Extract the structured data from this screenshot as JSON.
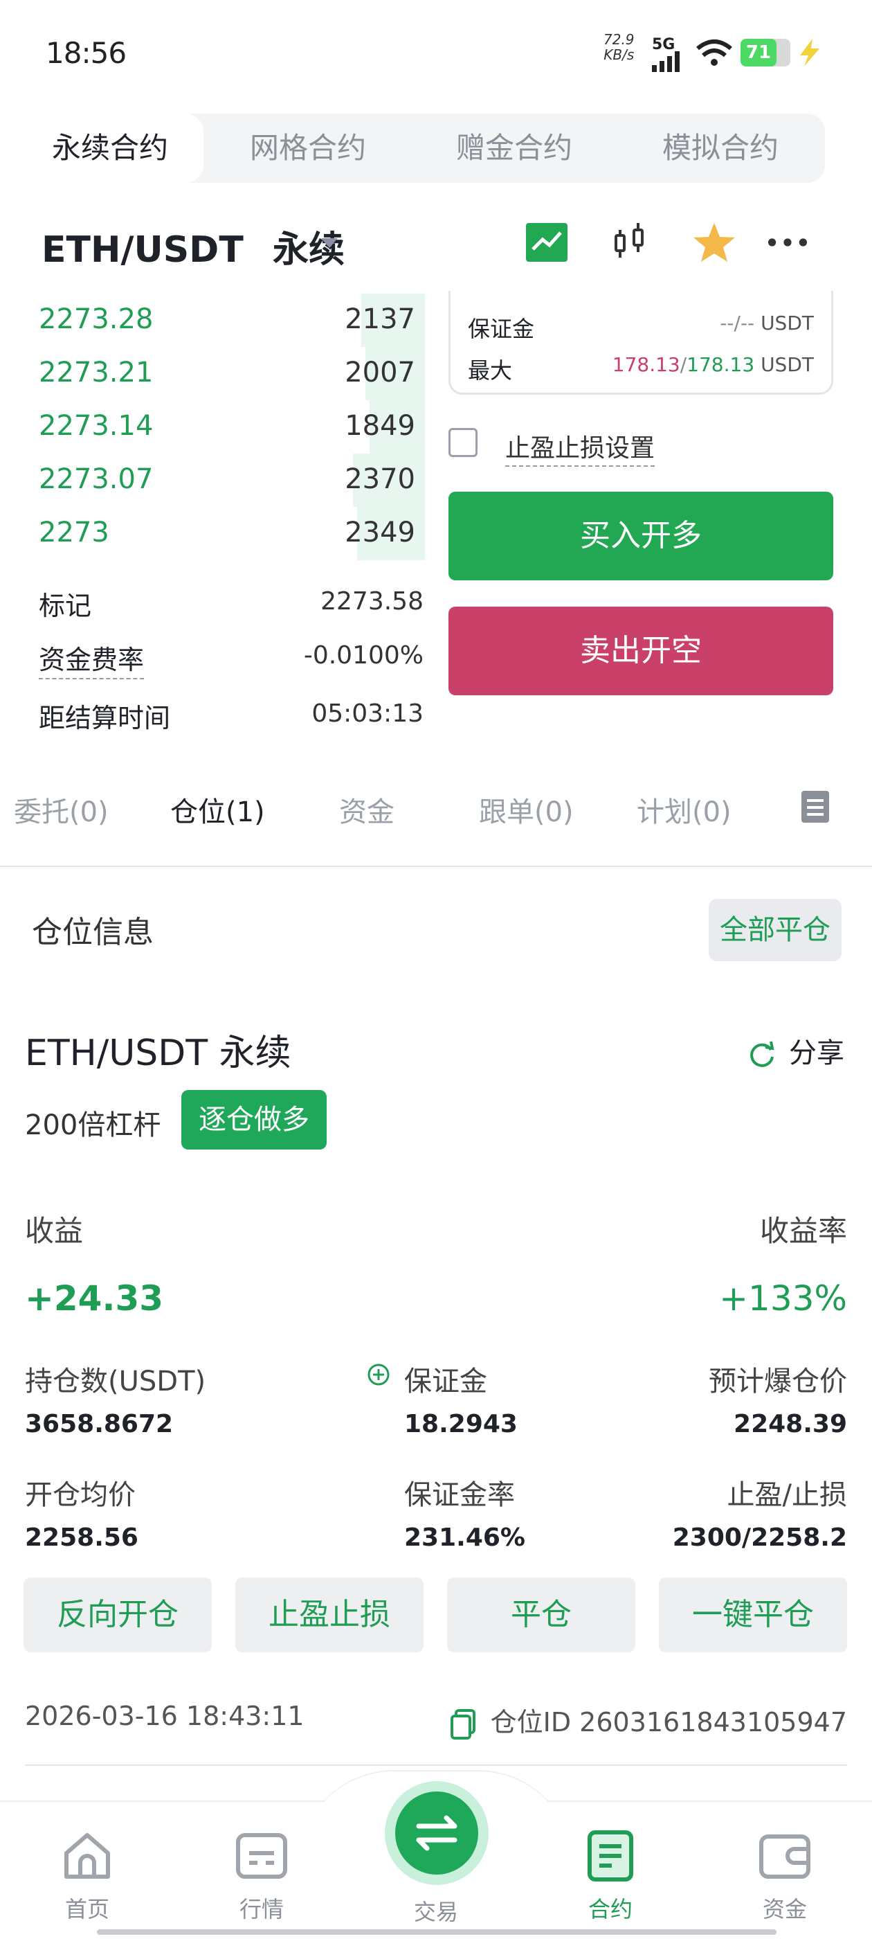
{
  "status_bar": {
    "time": "18:56",
    "net_speed_value": "72.9",
    "net_speed_unit": "KB/s",
    "network": "5G",
    "battery": "71"
  },
  "contract_tabs": [
    "永续合约",
    "网格合约",
    "赠金合约",
    "模拟合约"
  ],
  "header": {
    "pair": "ETH/USDT",
    "type": "永续"
  },
  "order_book": [
    {
      "price": "2273.28",
      "qty": "2137",
      "depth": 0.15
    },
    {
      "price": "2273.21",
      "qty": "2007",
      "depth": 0.14
    },
    {
      "price": "2273.14",
      "qty": "1849",
      "depth": 0.13
    },
    {
      "price": "2273.07",
      "qty": "2370",
      "depth": 0.17
    },
    {
      "price": "2273",
      "qty": "2349",
      "depth": 0.16
    }
  ],
  "market_stats": {
    "mark_label": "标记",
    "mark_value": "2273.58",
    "funding_label": "资金费率",
    "funding_value": "-0.0100%",
    "settle_label": "距结算时间",
    "settle_value": "05:03:13"
  },
  "order_panel": {
    "margin_label": "保证金",
    "margin_value": "--/--",
    "margin_unit": "USDT",
    "max_label": "最大",
    "max_buy": "178.13",
    "max_sep": "/",
    "max_sell": "178.13",
    "max_unit": "USDT",
    "tpsl_label": "止盈止损设置",
    "buy_label": "买入开多",
    "sell_label": "卖出开空"
  },
  "position_tabs": [
    "委托(0)",
    "仓位(1)",
    "资金",
    "跟单(0)",
    "计划(0)"
  ],
  "position": {
    "section_title": "仓位信息",
    "close_all": "全部平仓",
    "pair": "ETH/USDT 永续",
    "share": "分享",
    "leverage": "200倍杠杆",
    "mode": "逐仓做多",
    "pnl_label": "收益",
    "pnl_value": "+24.33",
    "roe_label": "收益率",
    "roe_value": "+133%",
    "size_label": "持仓数(USDT)",
    "size_value": "3658.8672",
    "margin_label": "保证金",
    "margin_value": "18.2943",
    "liq_label": "预计爆仓价",
    "liq_value": "2248.39",
    "entry_label": "开仓均价",
    "entry_value": "2258.56",
    "margin_ratio_label": "保证金率",
    "margin_ratio_value": "231.46%",
    "tpsl_label": "止盈/止损",
    "tpsl_value": "2300/2258.2",
    "actions": [
      "反向开仓",
      "止盈止损",
      "平仓",
      "一键平仓"
    ],
    "time": "2026-03-16 18:43:11",
    "id_label": "仓位ID",
    "id_value": "2603161843105947"
  },
  "bottom_nav": [
    "首页",
    "行情",
    "交易",
    "合约",
    "资金"
  ],
  "colors": {
    "green": "#1f9d55",
    "red": "#c9406b",
    "buy": "#22a752",
    "sell": "#c94068"
  }
}
